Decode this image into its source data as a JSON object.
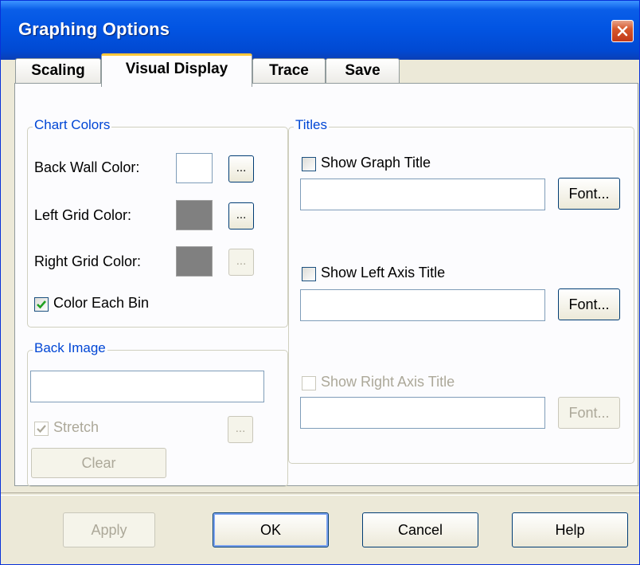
{
  "window": {
    "title": "Graphing Options"
  },
  "tabs": [
    {
      "label": "Scaling"
    },
    {
      "label": "Visual Display"
    },
    {
      "label": "Trace"
    },
    {
      "label": "Save"
    }
  ],
  "chart_colors": {
    "legend": "Chart Colors",
    "back_wall_label": "Back Wall Color:",
    "left_grid_label": "Left Grid Color:",
    "right_grid_label": "Right Grid Color:",
    "browse_label": "...",
    "color_each_bin_label": "Color Each Bin",
    "color_each_bin_checked": true,
    "back_wall_color": "#ffffff",
    "left_grid_color": "#808080",
    "right_grid_color": "#808080"
  },
  "back_image": {
    "legend": "Back Image",
    "path_value": "",
    "stretch_label": "Stretch",
    "stretch_checked": true,
    "browse_label": "...",
    "clear_label": "Clear"
  },
  "titles": {
    "legend": "Titles",
    "graph_title_label": "Show Graph Title",
    "graph_title_value": "",
    "left_axis_label": "Show Left Axis Title",
    "left_axis_value": "",
    "right_axis_label": "Show Right Axis Title",
    "right_axis_value": "",
    "font_label": "Font..."
  },
  "footer": {
    "apply_label": "Apply",
    "ok_label": "OK",
    "cancel_label": "Cancel",
    "help_label": "Help"
  },
  "colors": {
    "title_bar": "#0255e3",
    "legend_text": "#0046d5",
    "active_tab_highlight": "#ffc83c",
    "dialog_face": "#ece9d8",
    "checkmark": "#21a121"
  }
}
